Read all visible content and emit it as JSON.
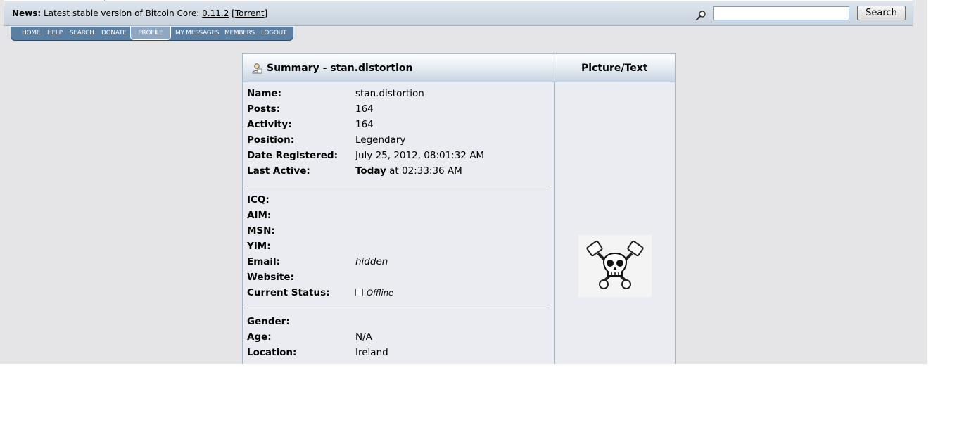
{
  "news": {
    "label": "News:",
    "text": "Latest stable version of Bitcoin Core: ",
    "version_link": "0.11.2",
    "torrent_link": "Torrent"
  },
  "search": {
    "placeholder": "",
    "button_label": "Search"
  },
  "menu": {
    "items": [
      "HOME",
      "HELP",
      "SEARCH",
      "DONATE",
      "PROFILE",
      "MY MESSAGES",
      "MEMBERS",
      "LOGOUT"
    ],
    "active": "PROFILE"
  },
  "summary": {
    "title": "Summary - stan.distortion",
    "picture_header": "Picture/Text",
    "fields": {
      "name": {
        "label": "Name:",
        "value": "stan.distortion"
      },
      "posts": {
        "label": "Posts:",
        "value": "164"
      },
      "activity": {
        "label": "Activity:",
        "value": "164"
      },
      "position": {
        "label": "Position:",
        "value": "Legendary"
      },
      "registered": {
        "label": "Date Registered:",
        "value": "July 25, 2012, 08:01:32 AM"
      },
      "last_active": {
        "label": "Last Active:",
        "value_bold": "Today",
        "value_rest": " at 02:33:36 AM"
      },
      "icq": {
        "label": "ICQ:",
        "value": ""
      },
      "aim": {
        "label": "AIM:",
        "value": ""
      },
      "msn": {
        "label": "MSN:",
        "value": ""
      },
      "yim": {
        "label": "YIM:",
        "value": ""
      },
      "email": {
        "label": "Email:",
        "value": "hidden"
      },
      "website": {
        "label": "Website:",
        "value": ""
      },
      "status": {
        "label": "Current Status:",
        "value": "Offline"
      },
      "gender": {
        "label": "Gender:",
        "value": ""
      },
      "age": {
        "label": "Age:",
        "value": "N/A"
      },
      "location": {
        "label": "Location:",
        "value": "Ireland"
      }
    }
  },
  "icons": {
    "search": "magnifier-icon",
    "user": "user-icon",
    "avatar": "skull-pistons-avatar"
  }
}
